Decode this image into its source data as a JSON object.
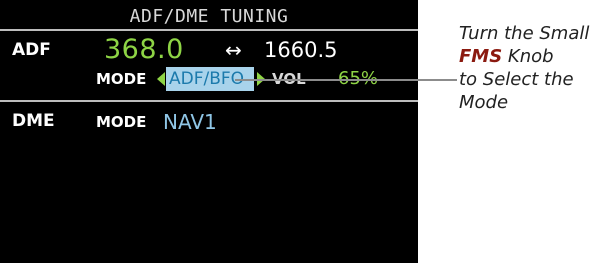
{
  "screen": {
    "title": "ADF/DME TUNING",
    "adf": {
      "label": "ADF",
      "active_freq": "368.0",
      "swap_symbol": "↔",
      "standby_freq": "1660.5",
      "mode_label": "MODE",
      "mode_value": "ADF/BFO",
      "vol_label": "VOL",
      "vol_value": "65%"
    },
    "dme": {
      "label": "DME",
      "mode_label": "MODE",
      "mode_value": "NAV1"
    }
  },
  "annotation": {
    "line1": "Turn the Small",
    "knob_name": "FMS",
    "line2_rest": " Knob",
    "line3": "to Select the",
    "line4": "Mode"
  },
  "colors": {
    "active_green": "#8ed445",
    "selected_bg": "#a8d3eb",
    "selected_text": "#1b7aac",
    "cyan_value": "#8fc6e6",
    "fms_red": "#8b1a10"
  }
}
